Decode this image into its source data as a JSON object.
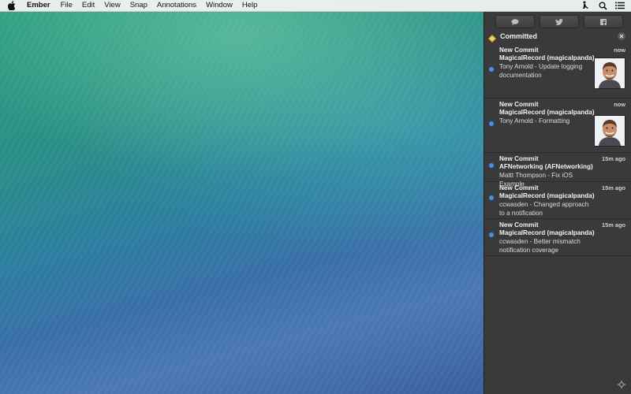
{
  "menubar": {
    "app_name": "Ember",
    "items": [
      "File",
      "Edit",
      "View",
      "Snap",
      "Annotations",
      "Window",
      "Help"
    ]
  },
  "panel": {
    "share_buttons": [
      "messages-icon",
      "twitter-icon",
      "facebook-icon"
    ],
    "section_title": "Committed",
    "notifications": [
      {
        "title": "New Commit",
        "repo": "MagicalRecord (magicalpanda)",
        "message": "Tony Arnold - Update logging documentation",
        "time": "now",
        "has_avatar": true
      },
      {
        "title": "New Commit",
        "repo": "MagicalRecord (magicalpanda)",
        "message": "Tony Arnold - Formatting",
        "time": "now",
        "has_avatar": true
      },
      {
        "title": "New Commit",
        "repo": "AFNetworking (AFNetworking)",
        "message": "Mattt Thompson - Fix iOS Example",
        "time": "15m ago",
        "has_avatar": false
      },
      {
        "title": "New Commit",
        "repo": "MagicalRecord (magicalpanda)",
        "message": "ccwasden - Changed approach to a notification",
        "time": "15m ago",
        "has_avatar": false
      },
      {
        "title": "New Commit",
        "repo": "MagicalRecord (magicalpanda)",
        "message": "ccwasden - Better mismatch notification coverage",
        "time": "15m ago",
        "has_avatar": false
      }
    ]
  },
  "colors": {
    "panel_bg": "#3a3a3a",
    "unread_dot": "#4a8fe0",
    "menubar_bg": "#f0f0f0"
  }
}
